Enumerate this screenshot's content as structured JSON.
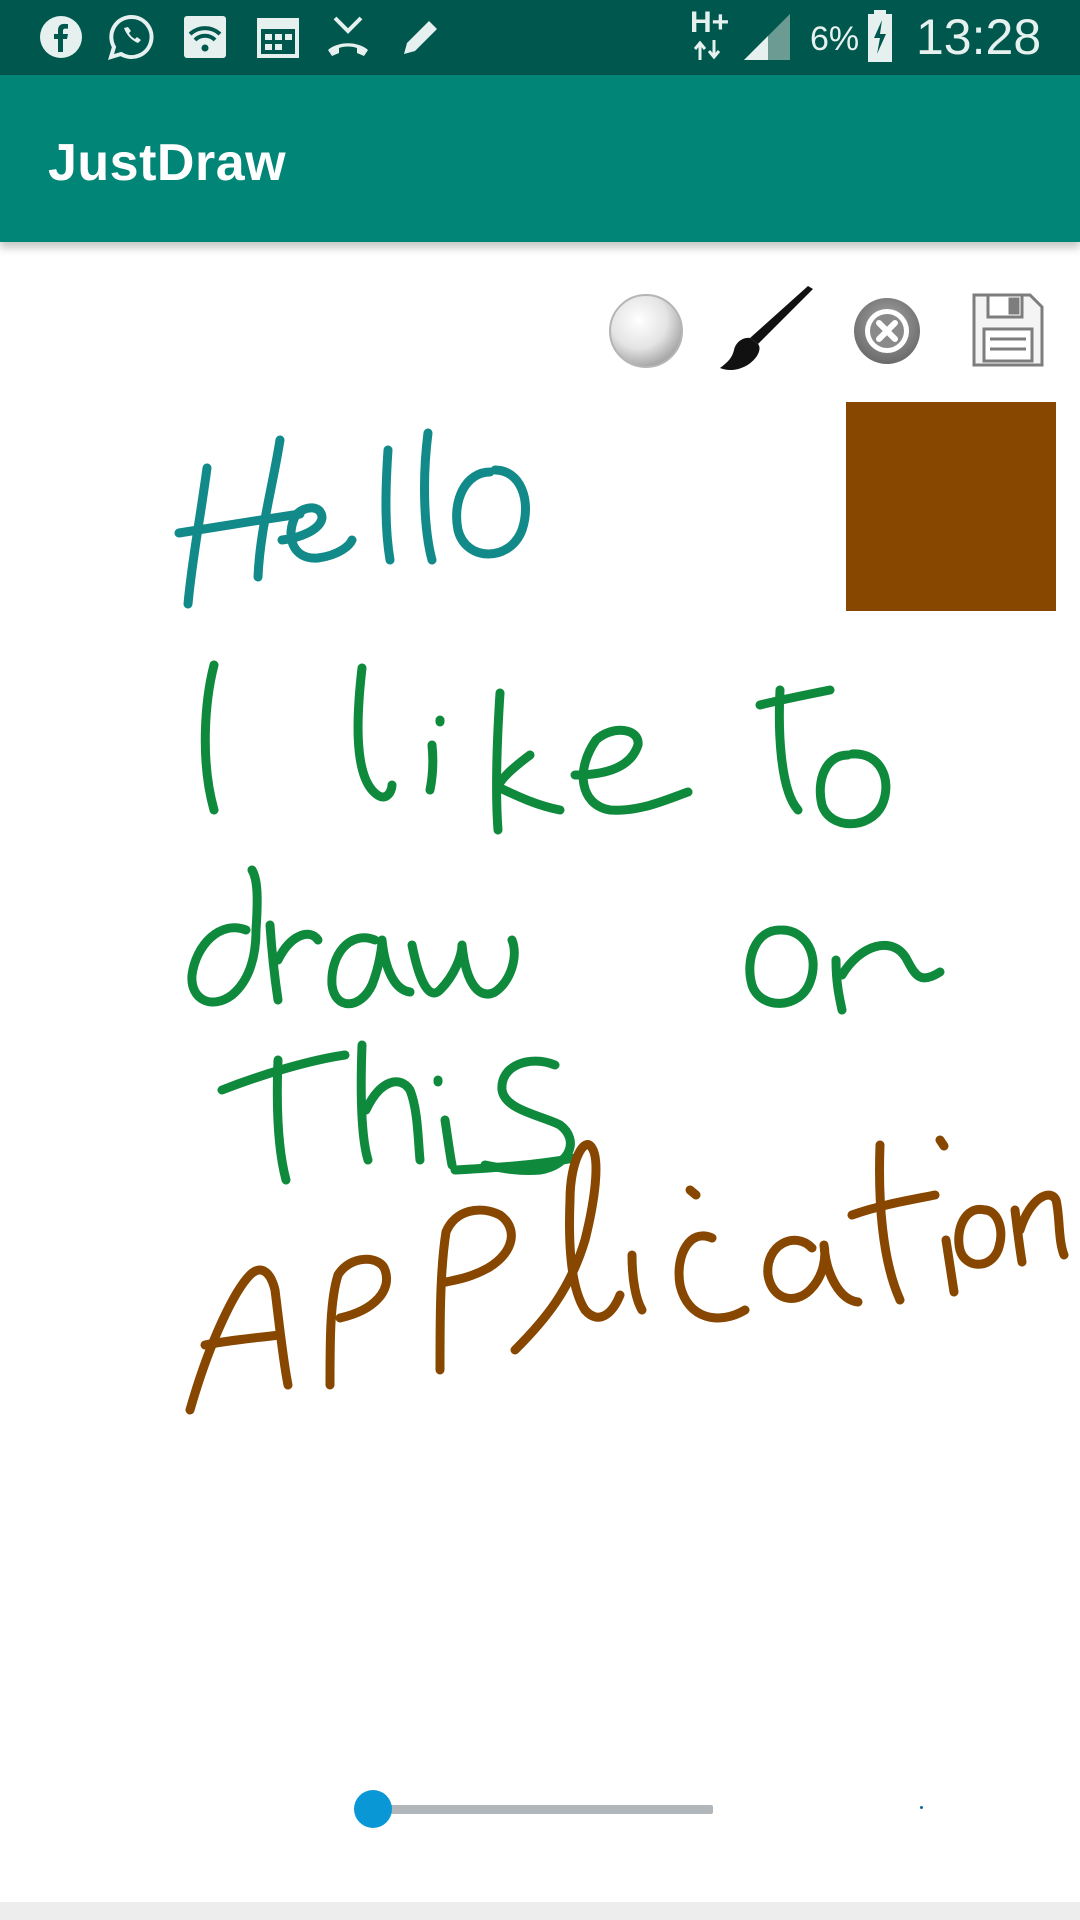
{
  "status_bar": {
    "time": "13:28",
    "battery_percent": "6%",
    "network_type": "H+",
    "left_icons": [
      "facebook-icon",
      "whatsapp-icon",
      "wifi-settings-icon",
      "calendar-icon",
      "missed-call-icon",
      "pencil-icon"
    ],
    "right_icons": [
      "network-arrows-icon",
      "signal-icon",
      "battery-charging-icon"
    ]
  },
  "app_bar": {
    "title": "JustDraw",
    "background": "#008576",
    "status_background": "#00574d"
  },
  "toolbar": {
    "buttons": [
      {
        "name": "eraser-button",
        "icon": "eraser-circle-icon"
      },
      {
        "name": "brush-button",
        "icon": "paintbrush-icon"
      },
      {
        "name": "clear-button",
        "icon": "close-circle-icon"
      },
      {
        "name": "save-button",
        "icon": "floppy-disk-icon"
      }
    ]
  },
  "current_color": {
    "hex": "#874700"
  },
  "drawing": {
    "stroke_colors": {
      "hello": "#138a8a",
      "body": "#0f8a3c",
      "application": "#874700"
    }
  },
  "brush_size_slider": {
    "value_fraction": 0.0,
    "track_color": "#b0b6ba",
    "thumb_color": "#0a97d6"
  }
}
